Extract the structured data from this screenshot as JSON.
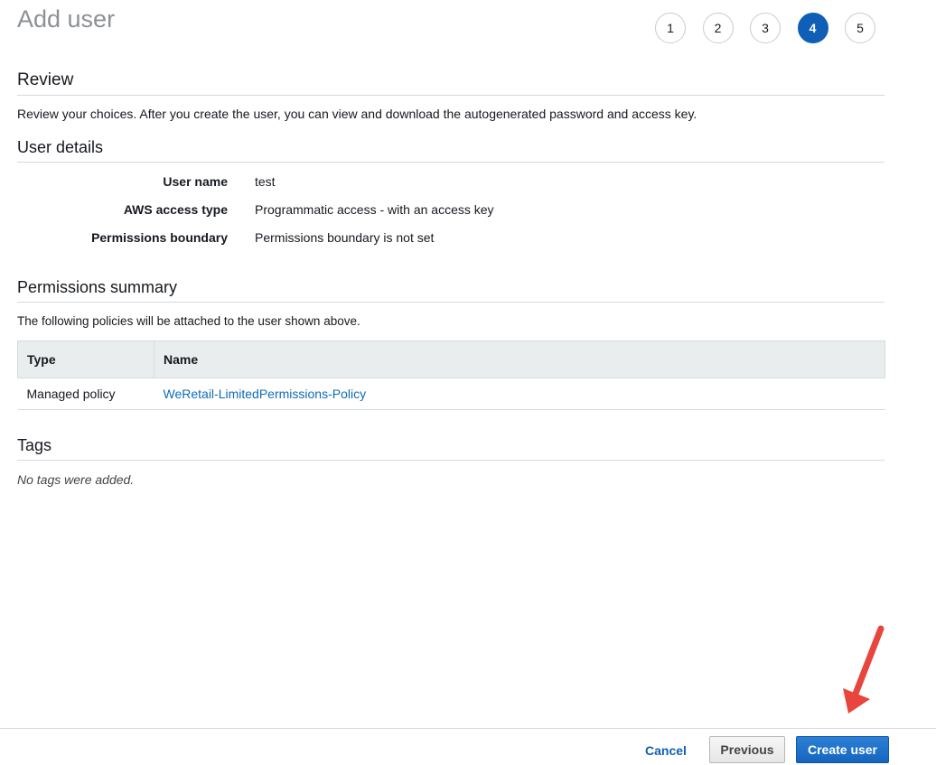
{
  "page": {
    "title": "Add user"
  },
  "steps": [
    "1",
    "2",
    "3",
    "4",
    "5"
  ],
  "active_step": 4,
  "review": {
    "heading": "Review",
    "description": "Review your choices. After you create the user, you can view and download the autogenerated password and access key."
  },
  "user_details": {
    "heading": "User details",
    "rows": [
      {
        "label": "User name",
        "value": "test"
      },
      {
        "label": "AWS access type",
        "value": "Programmatic access - with an access key"
      },
      {
        "label": "Permissions boundary",
        "value": "Permissions boundary is not set"
      }
    ]
  },
  "permissions_summary": {
    "heading": "Permissions summary",
    "description": "The following policies will be attached to the user shown above.",
    "columns": [
      "Type",
      "Name"
    ],
    "rows": [
      {
        "type": "Managed policy",
        "name": "WeRetail-LimitedPermissions-Policy"
      }
    ]
  },
  "tags": {
    "heading": "Tags",
    "empty_text": "No tags were added."
  },
  "footer": {
    "cancel_label": "Cancel",
    "previous_label": "Previous",
    "create_label": "Create user"
  },
  "colors": {
    "accent": "#0f5fb7",
    "link": "#0f6cb8",
    "annotation_arrow": "#e8453c"
  }
}
